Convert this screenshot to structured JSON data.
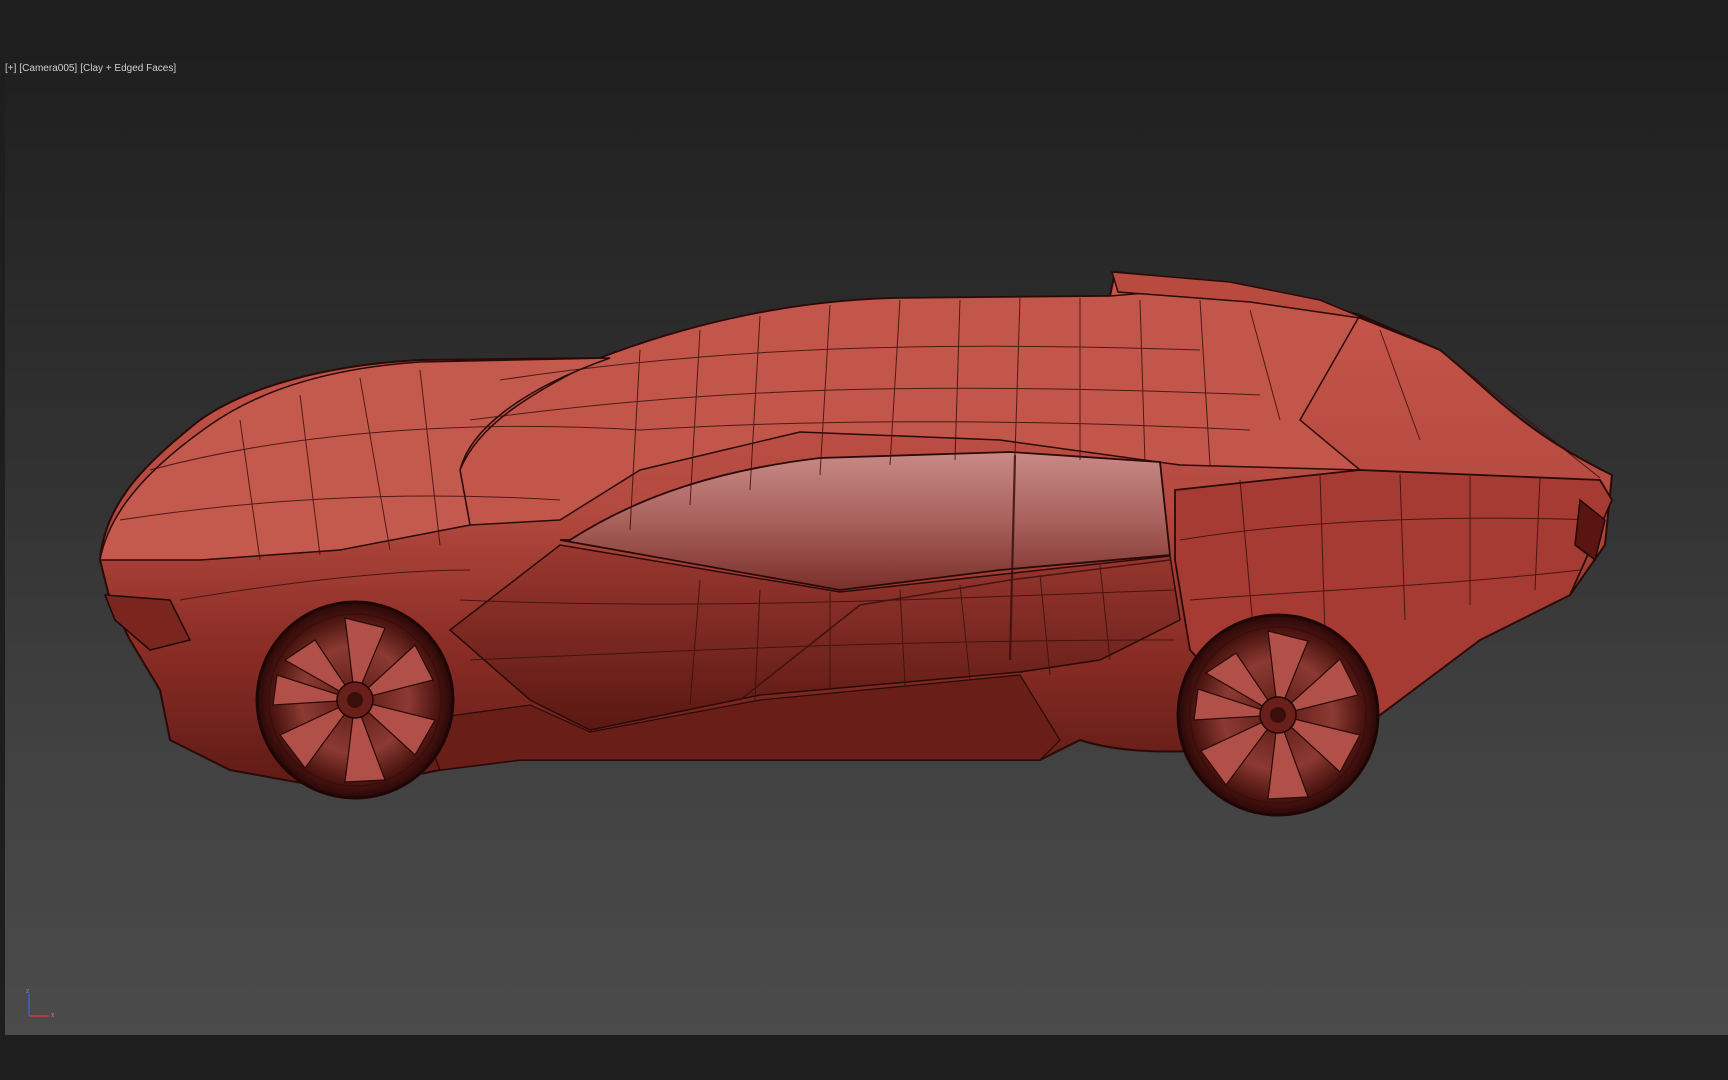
{
  "viewport": {
    "menu_plus": "[+]",
    "camera": "[Camera005]",
    "shading": "[Clay + Edged Faces]"
  },
  "gizmo": {
    "z_label": "z",
    "x_label": "x"
  },
  "colors": {
    "background": "#1e1e1e",
    "clay": "#a8423a",
    "edge": "#3a1010"
  },
  "scene": {
    "object": "car-model",
    "icons": [
      "axis-gizmo-icon"
    ]
  }
}
